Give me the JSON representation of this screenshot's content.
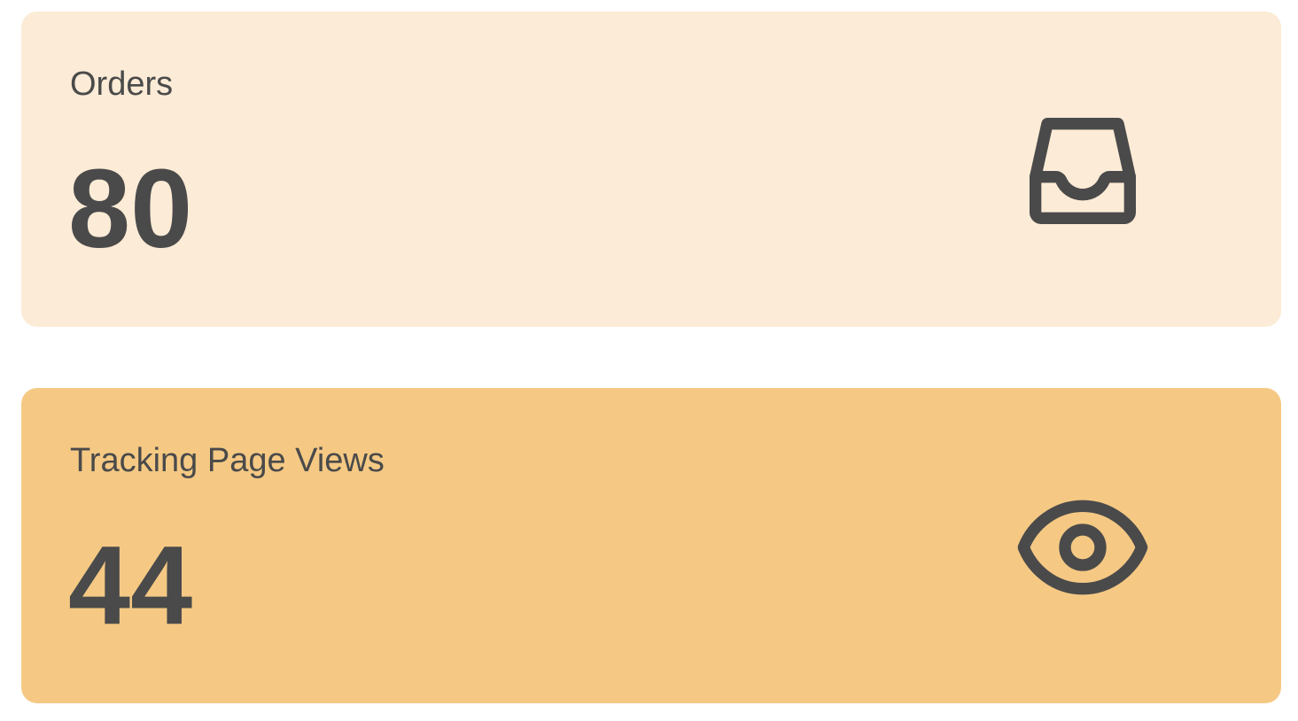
{
  "cards": [
    {
      "label": "Orders",
      "value": "80",
      "icon": "inbox-icon",
      "background": "#FCEBD6"
    },
    {
      "label": "Tracking Page Views",
      "value": "44",
      "icon": "eye-icon",
      "background": "#F5C984"
    }
  ],
  "colors": {
    "text": "#4A4A4A",
    "icon": "#4A4A4A"
  }
}
